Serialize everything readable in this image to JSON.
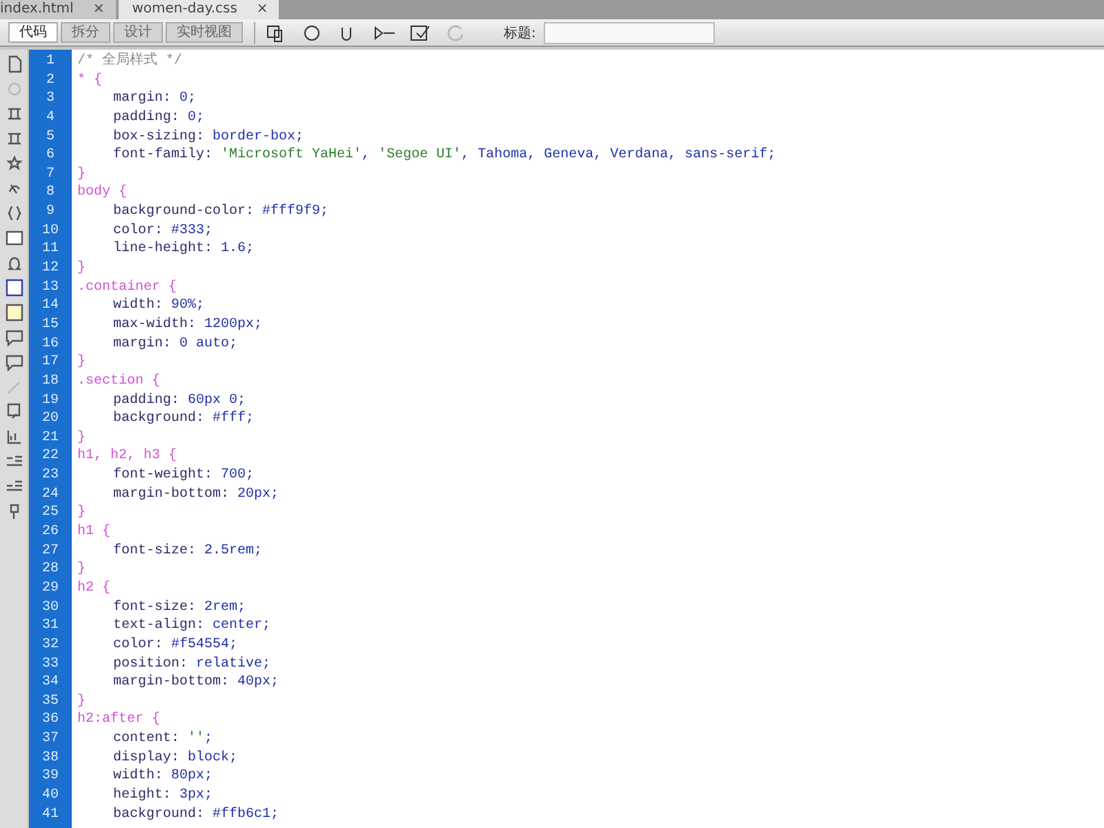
{
  "tabs": [
    {
      "label": "index.html",
      "close": "×",
      "selected": false
    },
    {
      "label": "women-day.css",
      "close": "×",
      "selected": true
    }
  ],
  "view_buttons": [
    {
      "label": "代码",
      "selected": true
    },
    {
      "label": "拆分",
      "selected": false
    },
    {
      "label": "设计",
      "selected": false
    },
    {
      "label": "实时视图",
      "selected": false
    }
  ],
  "title_field": {
    "label": "标题:"
  },
  "code_lines": [
    {
      "number": "1",
      "indented": false,
      "segments": [
        {
          "kind": "comment",
          "text": "/* 全局样式 */"
        }
      ]
    },
    {
      "number": "2",
      "indented": false,
      "segments": [
        {
          "kind": "selector",
          "text": "* {"
        }
      ]
    },
    {
      "number": "3",
      "indented": true,
      "segments": [
        {
          "kind": "property",
          "text": "margin:"
        },
        {
          "kind": "value",
          "text": " 0;"
        }
      ]
    },
    {
      "number": "4",
      "indented": true,
      "segments": [
        {
          "kind": "property",
          "text": "padding:"
        },
        {
          "kind": "value",
          "text": " 0;"
        }
      ]
    },
    {
      "number": "5",
      "indented": true,
      "segments": [
        {
          "kind": "property",
          "text": "box-sizing:"
        },
        {
          "kind": "value",
          "text": " border-box;"
        }
      ]
    },
    {
      "number": "6",
      "indented": true,
      "segments": [
        {
          "kind": "property",
          "text": "font-family:"
        },
        {
          "kind": "string",
          "text": " 'Microsoft YaHei'"
        },
        {
          "kind": "value",
          "text": ", "
        },
        {
          "kind": "string",
          "text": "'Segoe UI'"
        },
        {
          "kind": "value",
          "text": ", Tahoma, Geneva, Verdana, sans-serif;"
        }
      ]
    },
    {
      "number": "7",
      "indented": false,
      "segments": [
        {
          "kind": "selector",
          "text": "}"
        }
      ]
    },
    {
      "number": "8",
      "indented": false,
      "segments": [
        {
          "kind": "selector",
          "text": "body {"
        }
      ]
    },
    {
      "number": "9",
      "indented": true,
      "segments": [
        {
          "kind": "property",
          "text": "background-color:"
        },
        {
          "kind": "value",
          "text": " #fff9f9;"
        }
      ]
    },
    {
      "number": "10",
      "indented": true,
      "segments": [
        {
          "kind": "property",
          "text": "color:"
        },
        {
          "kind": "value",
          "text": " #333;"
        }
      ]
    },
    {
      "number": "11",
      "indented": true,
      "segments": [
        {
          "kind": "property",
          "text": "line-height:"
        },
        {
          "kind": "value",
          "text": " 1.6;"
        }
      ]
    },
    {
      "number": "12",
      "indented": false,
      "segments": [
        {
          "kind": "selector",
          "text": "}"
        }
      ]
    },
    {
      "number": "13",
      "indented": false,
      "segments": [
        {
          "kind": "selector",
          "text": ".container {"
        }
      ]
    },
    {
      "number": "14",
      "indented": true,
      "segments": [
        {
          "kind": "property",
          "text": "width:"
        },
        {
          "kind": "value",
          "text": " 90%;"
        }
      ]
    },
    {
      "number": "15",
      "indented": true,
      "segments": [
        {
          "kind": "property",
          "text": "max-width:"
        },
        {
          "kind": "value",
          "text": " 1200px;"
        }
      ]
    },
    {
      "number": "16",
      "indented": true,
      "segments": [
        {
          "kind": "property",
          "text": "margin:"
        },
        {
          "kind": "value",
          "text": " 0 auto;"
        }
      ]
    },
    {
      "number": "17",
      "indented": false,
      "segments": [
        {
          "kind": "selector",
          "text": "}"
        }
      ]
    },
    {
      "number": "18",
      "indented": false,
      "segments": [
        {
          "kind": "selector",
          "text": ".section {"
        }
      ]
    },
    {
      "number": "19",
      "indented": true,
      "segments": [
        {
          "kind": "property",
          "text": "padding:"
        },
        {
          "kind": "value",
          "text": " 60px 0;"
        }
      ]
    },
    {
      "number": "20",
      "indented": true,
      "segments": [
        {
          "kind": "property",
          "text": "background:"
        },
        {
          "kind": "value",
          "text": " #fff;"
        }
      ]
    },
    {
      "number": "21",
      "indented": false,
      "segments": [
        {
          "kind": "selector",
          "text": "}"
        }
      ]
    },
    {
      "number": "22",
      "indented": false,
      "segments": [
        {
          "kind": "selector",
          "text": "h1, h2, h3 {"
        }
      ]
    },
    {
      "number": "23",
      "indented": true,
      "segments": [
        {
          "kind": "property",
          "text": "font-weight:"
        },
        {
          "kind": "value",
          "text": " 700;"
        }
      ]
    },
    {
      "number": "24",
      "indented": true,
      "segments": [
        {
          "kind": "property",
          "text": "margin-bottom:"
        },
        {
          "kind": "value",
          "text": " 20px;"
        }
      ]
    },
    {
      "number": "25",
      "indented": false,
      "segments": [
        {
          "kind": "selector",
          "text": "}"
        }
      ]
    },
    {
      "number": "26",
      "indented": false,
      "segments": [
        {
          "kind": "selector",
          "text": "h1 {"
        }
      ]
    },
    {
      "number": "27",
      "indented": true,
      "segments": [
        {
          "kind": "property",
          "text": "font-size:"
        },
        {
          "kind": "value",
          "text": " 2.5rem;"
        }
      ]
    },
    {
      "number": "28",
      "indented": false,
      "segments": [
        {
          "kind": "selector",
          "text": "}"
        }
      ]
    },
    {
      "number": "29",
      "indented": false,
      "segments": [
        {
          "kind": "selector",
          "text": "h2 {"
        }
      ]
    },
    {
      "number": "30",
      "indented": true,
      "segments": [
        {
          "kind": "property",
          "text": "font-size:"
        },
        {
          "kind": "value",
          "text": " 2rem;"
        }
      ]
    },
    {
      "number": "31",
      "indented": true,
      "segments": [
        {
          "kind": "property",
          "text": "text-align:"
        },
        {
          "kind": "value",
          "text": " center;"
        }
      ]
    },
    {
      "number": "32",
      "indented": true,
      "segments": [
        {
          "kind": "property",
          "text": "color:"
        },
        {
          "kind": "value",
          "text": " #f54554;"
        }
      ]
    },
    {
      "number": "33",
      "indented": true,
      "segments": [
        {
          "kind": "property",
          "text": "position:"
        },
        {
          "kind": "value",
          "text": " relative;"
        }
      ]
    },
    {
      "number": "34",
      "indented": true,
      "segments": [
        {
          "kind": "property",
          "text": "margin-bottom:"
        },
        {
          "kind": "value",
          "text": " 40px;"
        }
      ]
    },
    {
      "number": "35",
      "indented": false,
      "segments": [
        {
          "kind": "selector",
          "text": "}"
        }
      ]
    },
    {
      "number": "36",
      "indented": false,
      "segments": [
        {
          "kind": "selector",
          "text": "h2:after {"
        }
      ]
    },
    {
      "number": "37",
      "indented": true,
      "segments": [
        {
          "kind": "property",
          "text": "content:"
        },
        {
          "kind": "string",
          "text": " ''"
        },
        {
          "kind": "value",
          "text": ";"
        }
      ]
    },
    {
      "number": "38",
      "indented": true,
      "segments": [
        {
          "kind": "property",
          "text": "display:"
        },
        {
          "kind": "value",
          "text": " block;"
        }
      ]
    },
    {
      "number": "39",
      "indented": true,
      "segments": [
        {
          "kind": "property",
          "text": "width:"
        },
        {
          "kind": "value",
          "text": " 80px;"
        }
      ]
    },
    {
      "number": "40",
      "indented": true,
      "segments": [
        {
          "kind": "property",
          "text": "height:"
        },
        {
          "kind": "value",
          "text": " 3px;"
        }
      ]
    },
    {
      "number": "41",
      "indented": true,
      "segments": [
        {
          "kind": "property",
          "text": "background:"
        },
        {
          "kind": "value",
          "text": " #ffb6c1;"
        }
      ]
    }
  ]
}
